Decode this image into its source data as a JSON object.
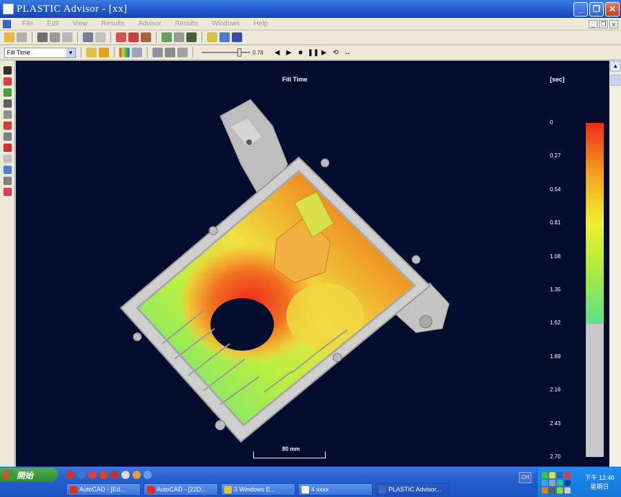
{
  "window": {
    "title": "PLASTIC Advisor - [xx]"
  },
  "menubar": {
    "items": [
      "File",
      "Edit",
      "View",
      "Results",
      "Advisor",
      "Results",
      "Windows",
      "Help"
    ]
  },
  "toolbar2": {
    "result_select": "Fill Time",
    "slider_value": "0.78",
    "slider_fraction": 0.8,
    "playback": [
      "◀",
      "▶",
      "■",
      "❚❚",
      "▶",
      "⟲",
      "↔"
    ]
  },
  "viewport": {
    "title": "Fill Time",
    "unit": "[sec]",
    "legend": [
      "0",
      "0.27",
      "0.54",
      "0.81",
      "1.08",
      "1.35",
      "1.62",
      "1.89",
      "2.16",
      "2.43",
      "2.70"
    ],
    "filled_fraction": 0.6,
    "scale_label": "80 mm"
  },
  "taskbar": {
    "start_label": "開始",
    "tasks": [
      {
        "label": "AutoCAD - [Ed...",
        "icon_color": "#d8301c"
      },
      {
        "label": "AutoCAD - [22D...",
        "icon_color": "#d8301c"
      },
      {
        "label": "3 Windows E...",
        "icon_color": "#e8c040"
      },
      {
        "label": "4 xxxx",
        "icon_color": "#f0f0f0"
      },
      {
        "label": "PLASTIC Advisor...",
        "icon_color": "#3b66c4"
      }
    ],
    "clock_line1": "下午 12:46",
    "clock_line2": "星期日",
    "lang": "CH"
  },
  "colors": {
    "viewport_bg": "#040c2e",
    "legend_high": "#ee2a1a",
    "legend_low": "#5de08a",
    "unfilled": "#c8c8c8"
  }
}
